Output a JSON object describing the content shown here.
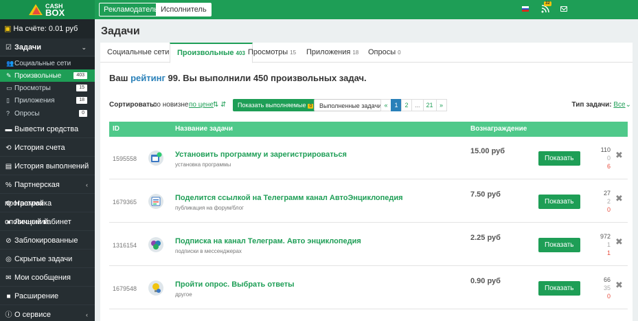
{
  "header": {
    "logo_top": "CASH",
    "logo_bottom": "BOX",
    "advertiser_label": "Рекламодатель",
    "executor_label": "Исполнитель",
    "rss_badge": "32"
  },
  "sidebar": {
    "balance": "На счёте: 0.01 руб",
    "tasks_label": "Задачи",
    "sub": [
      {
        "label": "Социальные сети",
        "count": ""
      },
      {
        "label": "Произвольные",
        "count": "403"
      },
      {
        "label": "Просмотры",
        "count": "15"
      },
      {
        "label": "Приложения",
        "count": "18"
      },
      {
        "label": "Опросы",
        "count": "0"
      }
    ],
    "items": [
      {
        "label": "Вывести средства"
      },
      {
        "label": "История счета"
      },
      {
        "label": "История выполнений"
      },
      {
        "label": "Партнерская программа"
      },
      {
        "label": "Настройка оповещений"
      },
      {
        "label": "Личный кабинет"
      },
      {
        "label": "Заблокированные"
      },
      {
        "label": "Скрытые задачи"
      },
      {
        "label": "Мои сообщения"
      },
      {
        "label": "Расширение"
      },
      {
        "label": "О сервисе"
      }
    ]
  },
  "main": {
    "title": "Задачи",
    "tabs": [
      {
        "label": "Социальные сети",
        "count": ""
      },
      {
        "label": "Произвольные",
        "count": "403"
      },
      {
        "label": "Просмотры",
        "count": "15"
      },
      {
        "label": "Приложения",
        "count": "18"
      },
      {
        "label": "Опросы",
        "count": "0"
      }
    ],
    "rating_prefix": "Ваш",
    "rating_link": "рейтинг",
    "rating_rest": "99. Вы выполнили 450 произвольных задач.",
    "sort_label": "Сортировать:",
    "sort_new": "по новизне",
    "sort_price": "по цене",
    "show_done_label": "Показать выполняемые",
    "show_done_count": "0",
    "completed_label": "Выполненные задачи",
    "pager": [
      "«",
      "1",
      "2",
      "...",
      "21",
      "»"
    ],
    "type_label": "Тип задачи:",
    "type_value": "Все",
    "columns": {
      "id": "ID",
      "name": "Название задачи",
      "reward": "Вознаграждение"
    },
    "show_button": "Показать",
    "rows": [
      {
        "id": "1595558",
        "title": "Установить программу и зарегистрироваться",
        "category": "установка программы",
        "reward": "15.00 руб",
        "s1": "110",
        "s2": "0",
        "s3": "6"
      },
      {
        "id": "1679365",
        "title": "Поделится ссылкой на Телеграмм канал АвтоЭнциклопедия",
        "category": "публикация на форум/блог",
        "reward": "7.50 руб",
        "s1": "27",
        "s2": "2",
        "s3": "0"
      },
      {
        "id": "1316154",
        "title": "Подписка на канал Телеграм. Авто энциклопедия",
        "category": "подписки в мессенджерах",
        "reward": "2.25 руб",
        "s1": "972",
        "s2": "1",
        "s3": "1"
      },
      {
        "id": "1679548",
        "title": "Пройти опрос. Выбрать ответы",
        "category": "другое",
        "reward": "0.90 руб",
        "s1": "66",
        "s2": "35",
        "s3": "0"
      }
    ]
  },
  "colors": {
    "brand_green": "#1e9e56",
    "header_green": "#4fc98a",
    "sidebar_dark": "#262e32",
    "link_blue": "#2980b9",
    "danger": "#e74c3c"
  }
}
